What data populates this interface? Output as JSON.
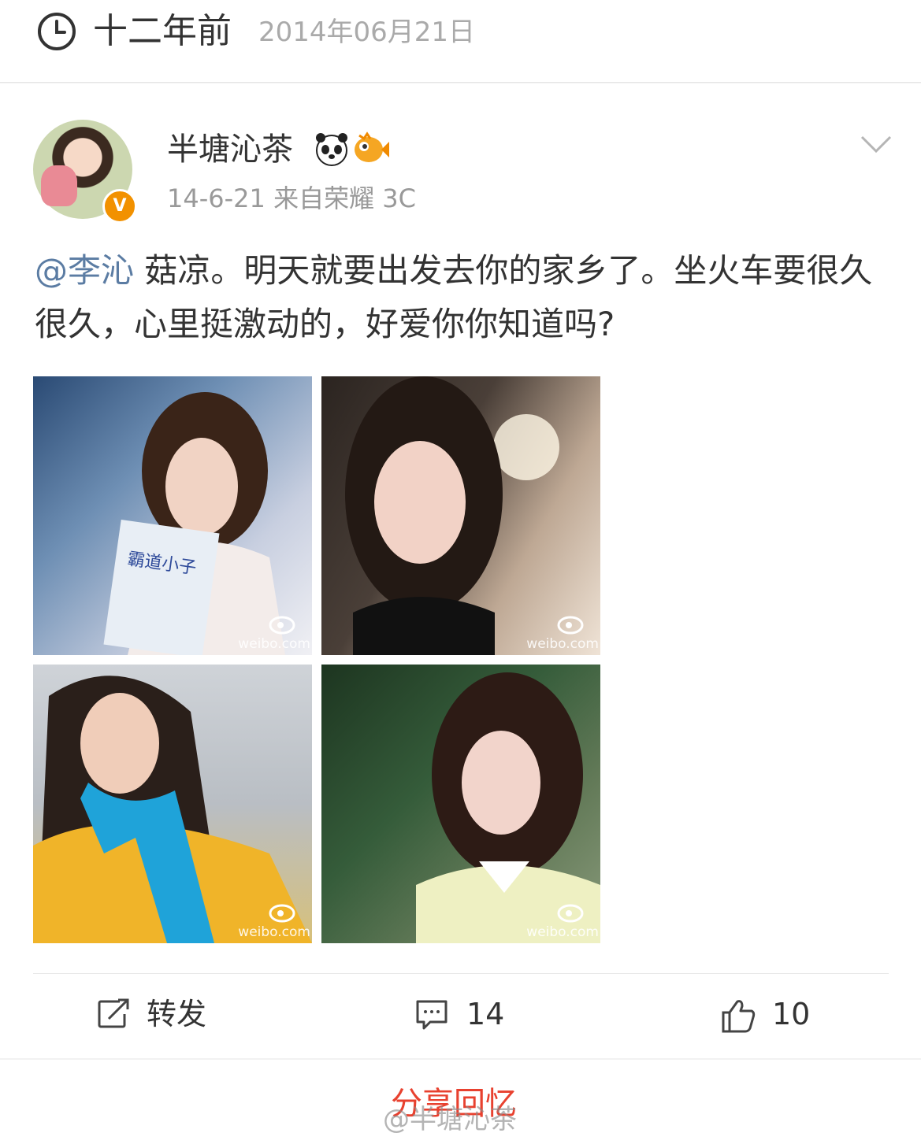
{
  "header": {
    "ago_label": "十二年前",
    "date": "2014年06月21日"
  },
  "post": {
    "username": "半塘沁茶",
    "badge": "V",
    "meta": "14-6-21  来自荣耀 3C",
    "mention": "@李沁",
    "body": " 菇凉。明天就要出发去你的家乡了。坐火车要很久很久，心里挺激动的，好爱你你知道吗?",
    "image_watermark": "weibo.com",
    "images": [
      {
        "book_title": "霸道小子"
      },
      {},
      {},
      {}
    ]
  },
  "actions": {
    "repost_label": "转发",
    "comment_count": "14",
    "like_count": "10"
  },
  "footer": {
    "share_label": "分享回忆",
    "watermark": "@半塘沁茶"
  },
  "colors": {
    "mention": "#5b7ca3",
    "share": "#e8412f",
    "verified": "#f29100"
  }
}
